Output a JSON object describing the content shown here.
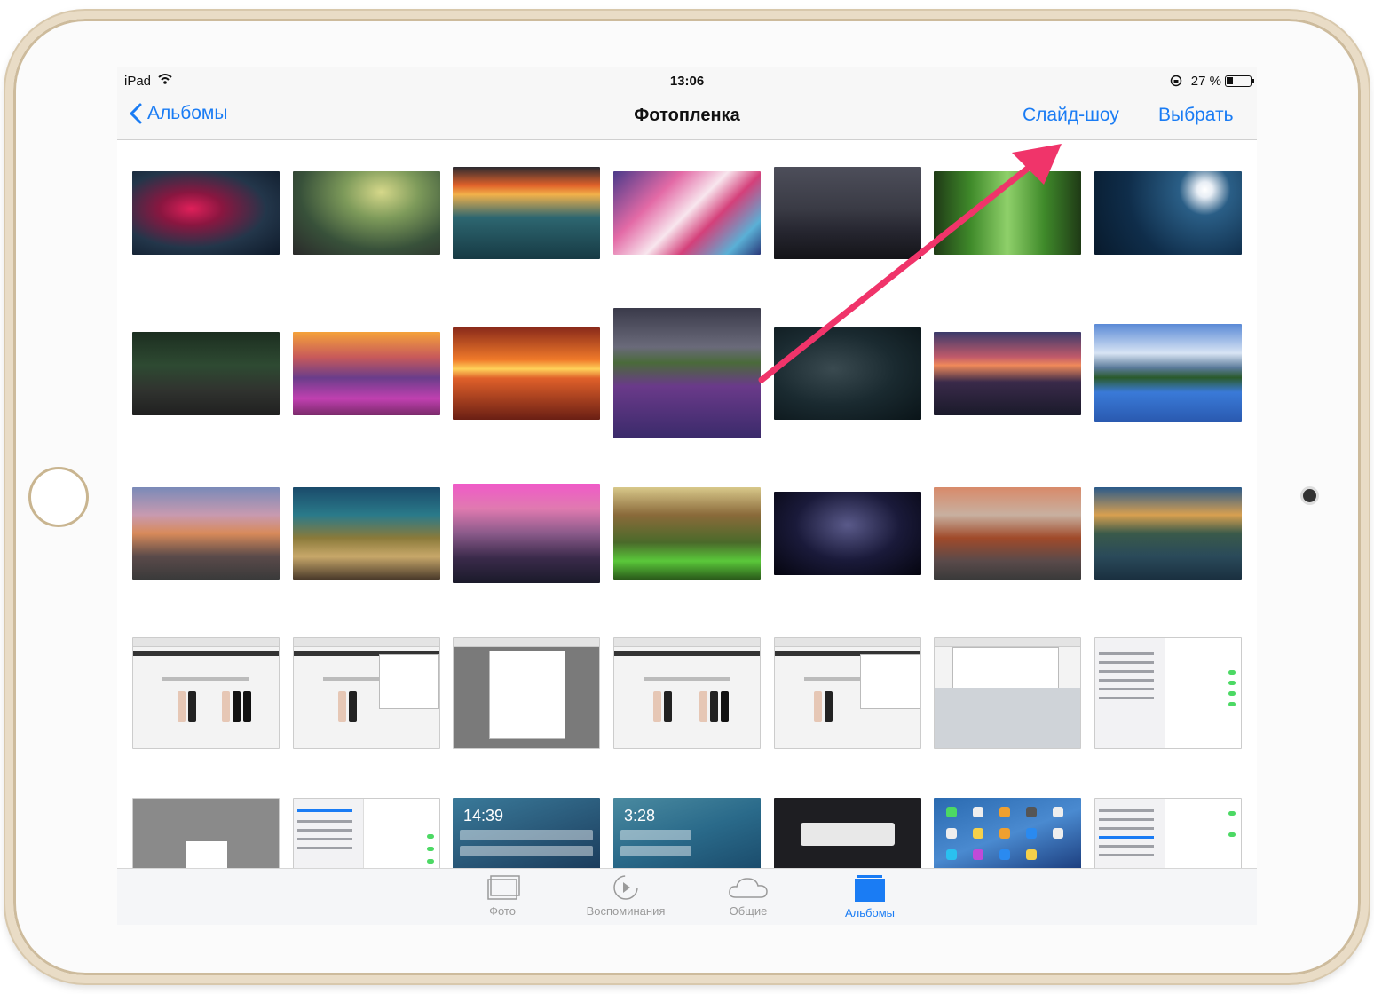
{
  "status_bar": {
    "carrier": "iPad",
    "time": "13:06",
    "battery": "27 %"
  },
  "nav": {
    "back_label": "Альбомы",
    "title": "Фотопленка",
    "slideshow_label": "Слайд-шоу",
    "select_label": "Выбрать"
  },
  "grid": {
    "photos": [
      "photo-red-tree",
      "photo-misty-forest",
      "photo-bokeh-flowers",
      "photo-colorful-clouds",
      "photo-foggy-city",
      "photo-green-alley",
      "photo-ship-moon",
      "photo-forest-road",
      "photo-mountain-flowers-sunrise",
      "photo-sea-sunset",
      "photo-lavender-tree",
      "photo-motorcycle-pier",
      "photo-ocean-dusk",
      "photo-lake-mountains",
      "photo-mountain-peak-dusk",
      "photo-coral-reef",
      "photo-pink-mountains",
      "photo-sunny-forest",
      "photo-milky-way",
      "photo-volcano",
      "photo-mountain-lake",
      "screenshot-store-iphone",
      "screenshot-store-share",
      "screenshot-settings-dialog",
      "screenshot-store-iphone-2",
      "screenshot-store-share-2",
      "screenshot-keyboard",
      "screenshot-settings-icloud",
      "screenshot-settings-alert",
      "screenshot-settings-list",
      "screenshot-lockscreen-1439",
      "screenshot-lockscreen-328",
      "screenshot-siri-message",
      "screenshot-home-screen",
      "screenshot-settings-toggles"
    ],
    "lock_time_1": "14:39",
    "lock_time_2": "3:28"
  },
  "tabs": [
    {
      "label": "Фото",
      "icon": "photos-icon",
      "active": false
    },
    {
      "label": "Воспоминания",
      "icon": "memories-icon",
      "active": false
    },
    {
      "label": "Общие",
      "icon": "cloud-icon",
      "active": false
    },
    {
      "label": "Альбомы",
      "icon": "albums-icon",
      "active": true
    }
  ],
  "colors": {
    "accent": "#1a7cf4",
    "annotation_arrow": "#f0346a",
    "bezel_gold": "#e9dcc6"
  }
}
